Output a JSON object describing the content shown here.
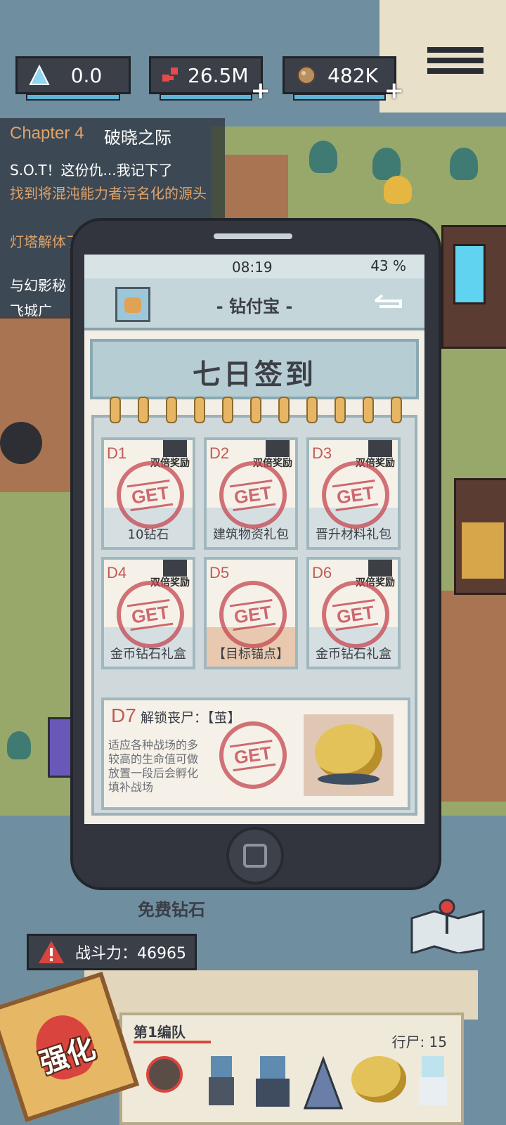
{
  "resources": {
    "crystal": {
      "icon": "crystal-icon",
      "value": "0.0"
    },
    "cells": {
      "icon": "cells-icon",
      "value": "26.5M"
    },
    "ore": {
      "icon": "ore-icon",
      "value": "482K"
    }
  },
  "quest": {
    "chapter": "Chapter 4",
    "chapter_name": "破晓之际",
    "items": [
      "S.O.T！这份仇...我记下了",
      "找到将混沌能力者污名化的源头",
      "灯塔解体了",
      "与幻影秘",
      "飞城广"
    ]
  },
  "phone": {
    "time": "08:19",
    "battery": "43 %",
    "app_title": "- 钻付宝 -",
    "banner_title": "七日签到",
    "days": [
      {
        "day": "D1",
        "label": "10钻石",
        "bonus": "双倍奖励",
        "stamp": "GET"
      },
      {
        "day": "D2",
        "label": "建筑物资礼包",
        "bonus": "双倍奖励",
        "stamp": "GET"
      },
      {
        "day": "D3",
        "label": "晋升材料礼包",
        "bonus": "双倍奖励",
        "stamp": "GET"
      },
      {
        "day": "D4",
        "label": "金币钻石礼盒",
        "bonus": "双倍奖励",
        "stamp": "GET"
      },
      {
        "day": "D5",
        "label": "【目标锚点】",
        "stamp": "GET"
      },
      {
        "day": "D6",
        "label": "金币钻石礼盒",
        "bonus": "双倍奖励",
        "stamp": "GET"
      }
    ],
    "day7": {
      "day": "D7",
      "title": "解锁丧尸：【茧】",
      "desc_lines": [
        "适应各种战场的多",
        "较高的生命值可做",
        "放置一段后会孵化",
        "填补战场"
      ],
      "stamp": "GET"
    }
  },
  "free_diamond": "免费钻石",
  "power": {
    "label": "战斗力：46965"
  },
  "team": {
    "name": "第1编队",
    "count": "行尸: 15"
  },
  "strengthen": "强化",
  "colors": {
    "accent_red": "#c4464f",
    "panel_dark": "#3a3f48",
    "gold": "#e6b866"
  }
}
